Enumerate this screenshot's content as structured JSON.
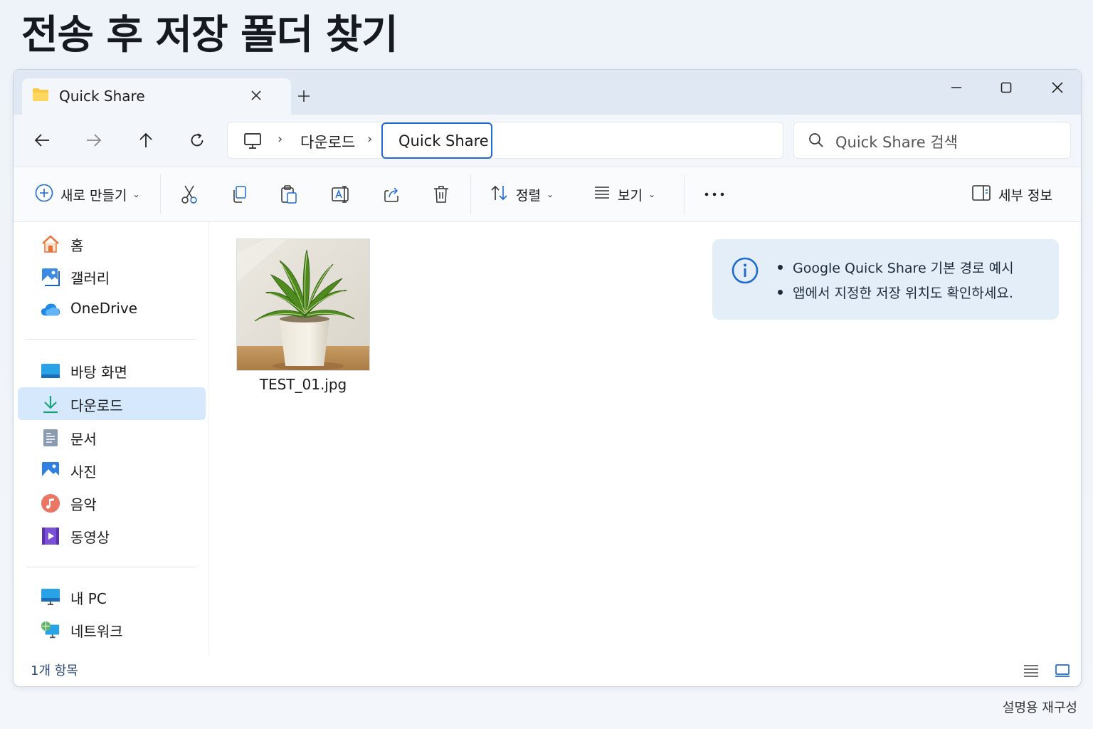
{
  "page": {
    "title": "전송 후 저장 폴더 찾기",
    "footnote": "설명용 재구성"
  },
  "tab": {
    "label": "Quick Share",
    "close_icon": "close-icon",
    "new_tab_icon": "plus-icon"
  },
  "window_controls": {
    "minimize": "minimize-icon",
    "maximize": "maximize-icon",
    "close": "close-icon"
  },
  "nav": {
    "back": "arrow-left-icon",
    "forward": "arrow-right-icon",
    "up": "arrow-up-icon",
    "refresh": "refresh-icon"
  },
  "address": {
    "crumbs": [
      "다운로드",
      "Quick Share"
    ],
    "current": "Quick Share"
  },
  "search": {
    "placeholder": "Quick Share 검색"
  },
  "toolbar": {
    "new_label": "새로 만들기",
    "sort_label": "정렬",
    "view_label": "보기",
    "details_label": "세부 정보",
    "actions": [
      "cut-icon",
      "copy-icon",
      "paste-icon",
      "rename-icon",
      "share-icon",
      "delete-icon"
    ]
  },
  "sidebar": {
    "quick": [
      {
        "label": "홈",
        "icon": "home-icon"
      },
      {
        "label": "갤러리",
        "icon": "gallery-icon"
      },
      {
        "label": "OneDrive",
        "icon": "cloud-icon"
      }
    ],
    "folders": [
      {
        "label": "바탕 화면",
        "icon": "desktop-icon"
      },
      {
        "label": "다운로드",
        "icon": "download-icon",
        "selected": true
      },
      {
        "label": "문서",
        "icon": "document-icon"
      },
      {
        "label": "사진",
        "icon": "photo-icon"
      },
      {
        "label": "음악",
        "icon": "music-icon"
      },
      {
        "label": "동영상",
        "icon": "video-icon"
      }
    ],
    "devices": [
      {
        "label": "내 PC",
        "icon": "pc-icon"
      },
      {
        "label": "네트워크",
        "icon": "network-icon"
      }
    ]
  },
  "files": [
    {
      "name": "TEST_01.jpg",
      "thumbnail": "plant-photo"
    }
  ],
  "info": {
    "lines": [
      "Google Quick Share 기본 경로 예시",
      "앱에서 지정한 저장 위치도 확인하세요."
    ]
  },
  "status": {
    "count": "1개 항목"
  },
  "colors": {
    "accent": "#1f6ad1",
    "selected": "#d6e8fb",
    "titlebar": "#dfe8f3",
    "info_bg": "#e3eef9"
  }
}
